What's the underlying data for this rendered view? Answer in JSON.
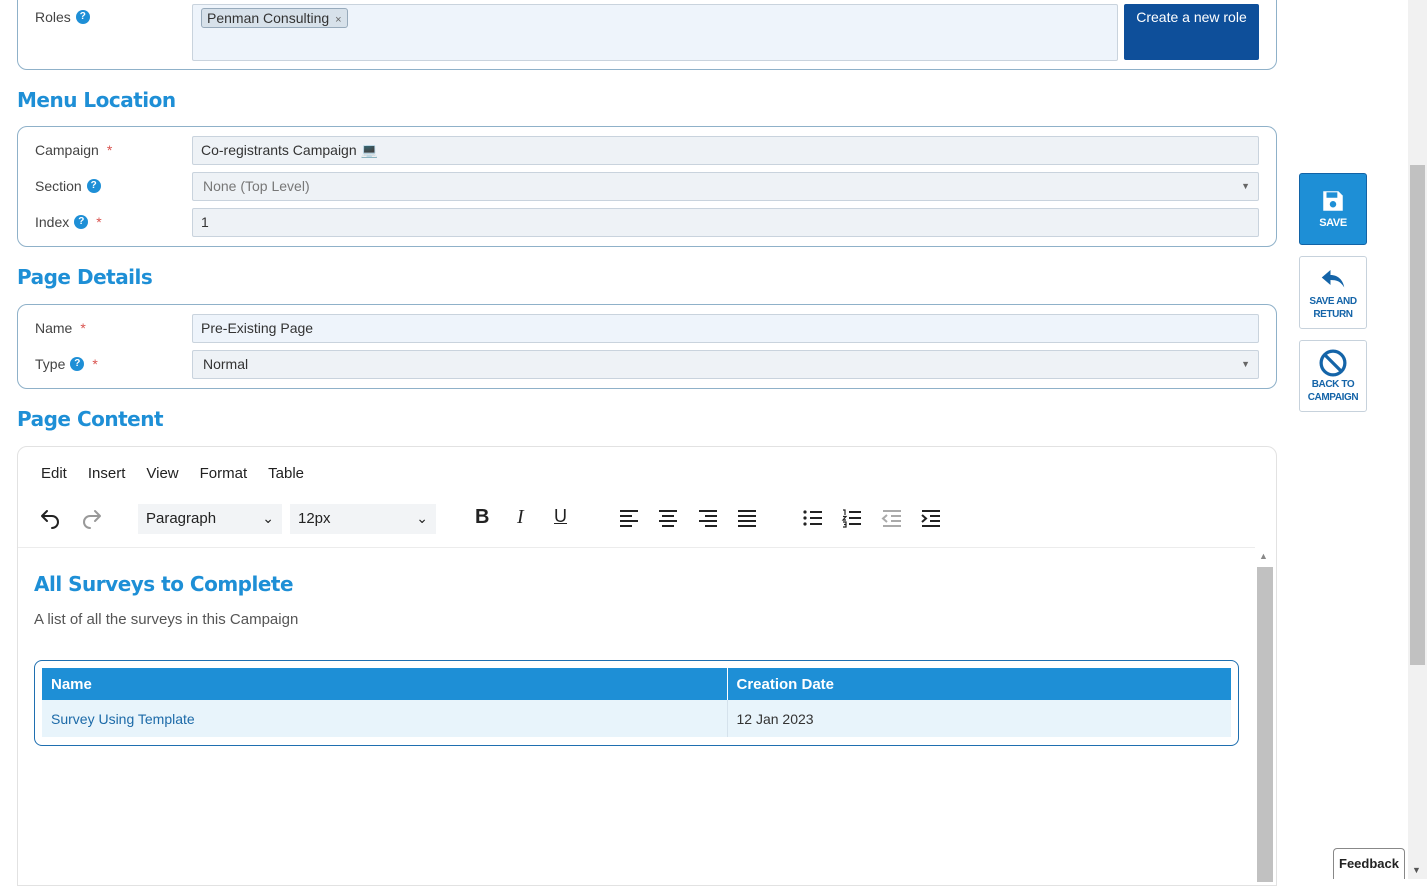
{
  "roles": {
    "label": "Roles",
    "tag": "Penman Consulting",
    "tag_remove": "×",
    "create_button": "Create a new role"
  },
  "menu_location": {
    "title": "Menu Location",
    "campaign_label": "Campaign",
    "campaign_value": "Co-registrants Campaign 💻",
    "section_label": "Section",
    "section_value": "None (Top Level)",
    "index_label": "Index",
    "index_value": "1"
  },
  "page_details": {
    "title": "Page Details",
    "name_label": "Name",
    "name_value": "Pre-Existing Page",
    "type_label": "Type",
    "type_value": "Normal"
  },
  "page_content": {
    "title": "Page Content",
    "menu": [
      "Edit",
      "Insert",
      "View",
      "Format",
      "Table"
    ],
    "block_format": "Paragraph",
    "font_size": "12px",
    "body": {
      "heading": "All Surveys to Complete",
      "description": "A list of all the surveys in this Campaign",
      "table": {
        "headers": [
          "Name",
          "Creation Date"
        ],
        "rows": [
          [
            "Survey Using Template",
            "12 Jan 2023"
          ]
        ]
      }
    }
  },
  "side_actions": {
    "save": "SAVE",
    "save_return_1": "SAVE AND",
    "save_return_2": "RETURN",
    "back_1": "BACK TO",
    "back_2": "CAMPAIGN"
  },
  "required_mark": "*",
  "help_mark": "?",
  "feedback": "Feedback",
  "colors": {
    "accent": "#1e8fd6",
    "primary_dark": "#0e4f9a"
  }
}
